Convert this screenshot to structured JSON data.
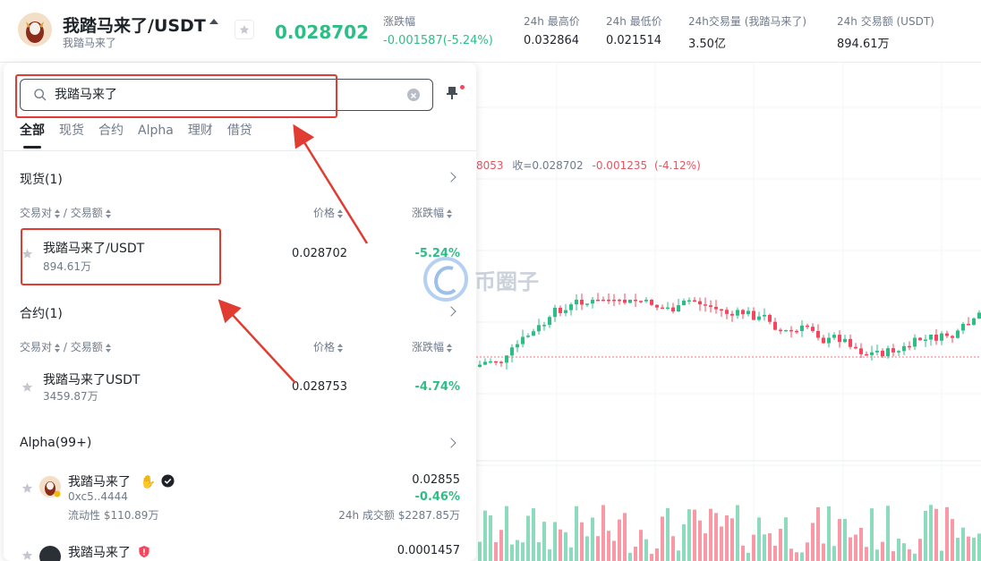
{
  "header": {
    "pair_title": "我踏马来了/USDT",
    "pair_sub": "我踏马来了",
    "last_price": "0.028702",
    "stats": [
      {
        "label": "涨跌幅",
        "value": "-0.001587(-5.24%)",
        "color": "green"
      },
      {
        "label": "24h 最高价",
        "value": "0.032864"
      },
      {
        "label": "24h 最低价",
        "value": "0.021514"
      },
      {
        "label": "24h交易量 (我踏马来了)",
        "value": "3.50亿"
      },
      {
        "label": "24h 交易额 (USDT)",
        "value": "894.61万"
      }
    ]
  },
  "chart": {
    "info_partial": "8053",
    "close_label": "收=0.028702",
    "change": "-0.001235",
    "change_pct": "(-4.12%)"
  },
  "search": {
    "value": "我踏马来了",
    "tabs": [
      "全部",
      "现货",
      "合约",
      "Alpha",
      "理财",
      "借贷"
    ],
    "active_tab": 0
  },
  "columns": {
    "pair": "交易对",
    "volume": "交易额",
    "price": "价格",
    "change": "涨跌幅"
  },
  "spot": {
    "title": "现货(1)",
    "rows": [
      {
        "name": "我踏马来了/USDT",
        "volume": "894.61万",
        "price": "0.028702",
        "change": "-5.24%"
      }
    ]
  },
  "futures": {
    "title": "合约(1)",
    "rows": [
      {
        "name": "我踏马来了USDT",
        "volume": "3459.87万",
        "price": "0.028753",
        "change": "-4.74%"
      }
    ]
  },
  "alpha": {
    "title": "Alpha(99+)",
    "rows": [
      {
        "name": "我踏马来了",
        "address": "0xc5..4444",
        "liquidity": "流动性 $110.89万",
        "price": "0.02855",
        "change": "-0.46%",
        "turnover": "24h 成交额 $2287.85万"
      },
      {
        "name": "我踏马来了",
        "price": "0.0001457"
      }
    ]
  },
  "watermark": "币圈子",
  "colors": {
    "up": "#2ebd85",
    "down": "#f6465d",
    "annotation": "#e03c31"
  }
}
